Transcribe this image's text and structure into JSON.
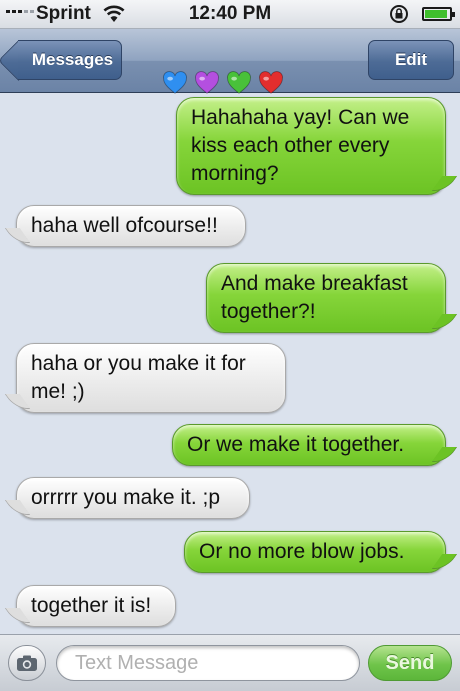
{
  "status_bar": {
    "carrier": "Sprint",
    "time": "12:40 PM",
    "battery_level": 0.9
  },
  "nav_bar": {
    "back_label": "Messages",
    "title_emoji": [
      {
        "name": "blue-heart-icon",
        "color": "#2f8ff0"
      },
      {
        "name": "purple-heart-icon",
        "color": "#b44fe0"
      },
      {
        "name": "green-heart-icon",
        "color": "#49c13a"
      },
      {
        "name": "red-heart-icon",
        "color": "#e32e2e"
      }
    ],
    "edit_label": "Edit"
  },
  "conversation": {
    "messages": [
      {
        "direction": "outgoing",
        "text": "Hahahaha yay! Can we kiss each other every morning?"
      },
      {
        "direction": "incoming",
        "text": "haha well ofcourse!!"
      },
      {
        "direction": "outgoing",
        "text": "And make breakfast together?!"
      },
      {
        "direction": "incoming",
        "text": "haha or you make it for me! ;)"
      },
      {
        "direction": "outgoing",
        "text": "Or we make it together."
      },
      {
        "direction": "incoming",
        "text": "orrrrr you make it. ;p"
      },
      {
        "direction": "outgoing",
        "text": "Or no more blow jobs."
      },
      {
        "direction": "incoming",
        "text": "together it is!"
      }
    ]
  },
  "compose_bar": {
    "placeholder": "Text Message",
    "value": "",
    "send_label": "Send"
  },
  "colors": {
    "outgoing_bubble": "#86d53a",
    "incoming_bubble": "#ececec",
    "background": "#dbe2ed",
    "nav_bar": "#7a90b0"
  }
}
